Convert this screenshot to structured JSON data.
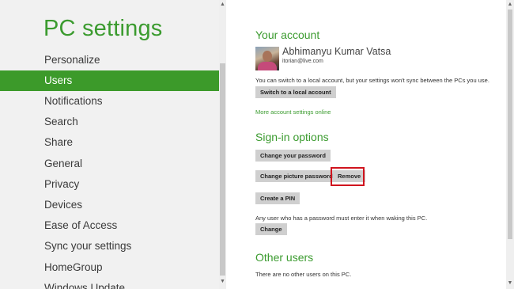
{
  "title": "PC settings",
  "nav": {
    "items": [
      {
        "label": "Personalize",
        "selected": false
      },
      {
        "label": "Users",
        "selected": true
      },
      {
        "label": "Notifications",
        "selected": false
      },
      {
        "label": "Search",
        "selected": false
      },
      {
        "label": "Share",
        "selected": false
      },
      {
        "label": "General",
        "selected": false
      },
      {
        "label": "Privacy",
        "selected": false
      },
      {
        "label": "Devices",
        "selected": false
      },
      {
        "label": "Ease of Access",
        "selected": false
      },
      {
        "label": "Sync your settings",
        "selected": false
      },
      {
        "label": "HomeGroup",
        "selected": false
      },
      {
        "label": "Windows Update",
        "selected": false
      }
    ]
  },
  "account": {
    "heading": "Your account",
    "name": "Abhimanyu Kumar Vatsa",
    "email": "itorian@live.com",
    "description": "You can switch to a local account, but your settings won't sync between the PCs you use.",
    "switch_button": "Switch to a local account",
    "more_link": "More account settings online"
  },
  "signin": {
    "heading": "Sign-in options",
    "change_password_button": "Change your password",
    "change_picture_password_button": "Change picture password",
    "remove_button": "Remove",
    "create_pin_button": "Create a PIN",
    "wake_text": "Any user who has a password must enter it when waking this PC.",
    "change_button": "Change"
  },
  "other_users": {
    "heading": "Other users",
    "text": "There are no other users on this PC."
  },
  "icons": {
    "scroll_up": "▲",
    "scroll_down": "▼"
  },
  "colors": {
    "accent": "#3c9a2a",
    "highlight_border": "#d0141e",
    "button_bg": "#cfcfcf"
  }
}
